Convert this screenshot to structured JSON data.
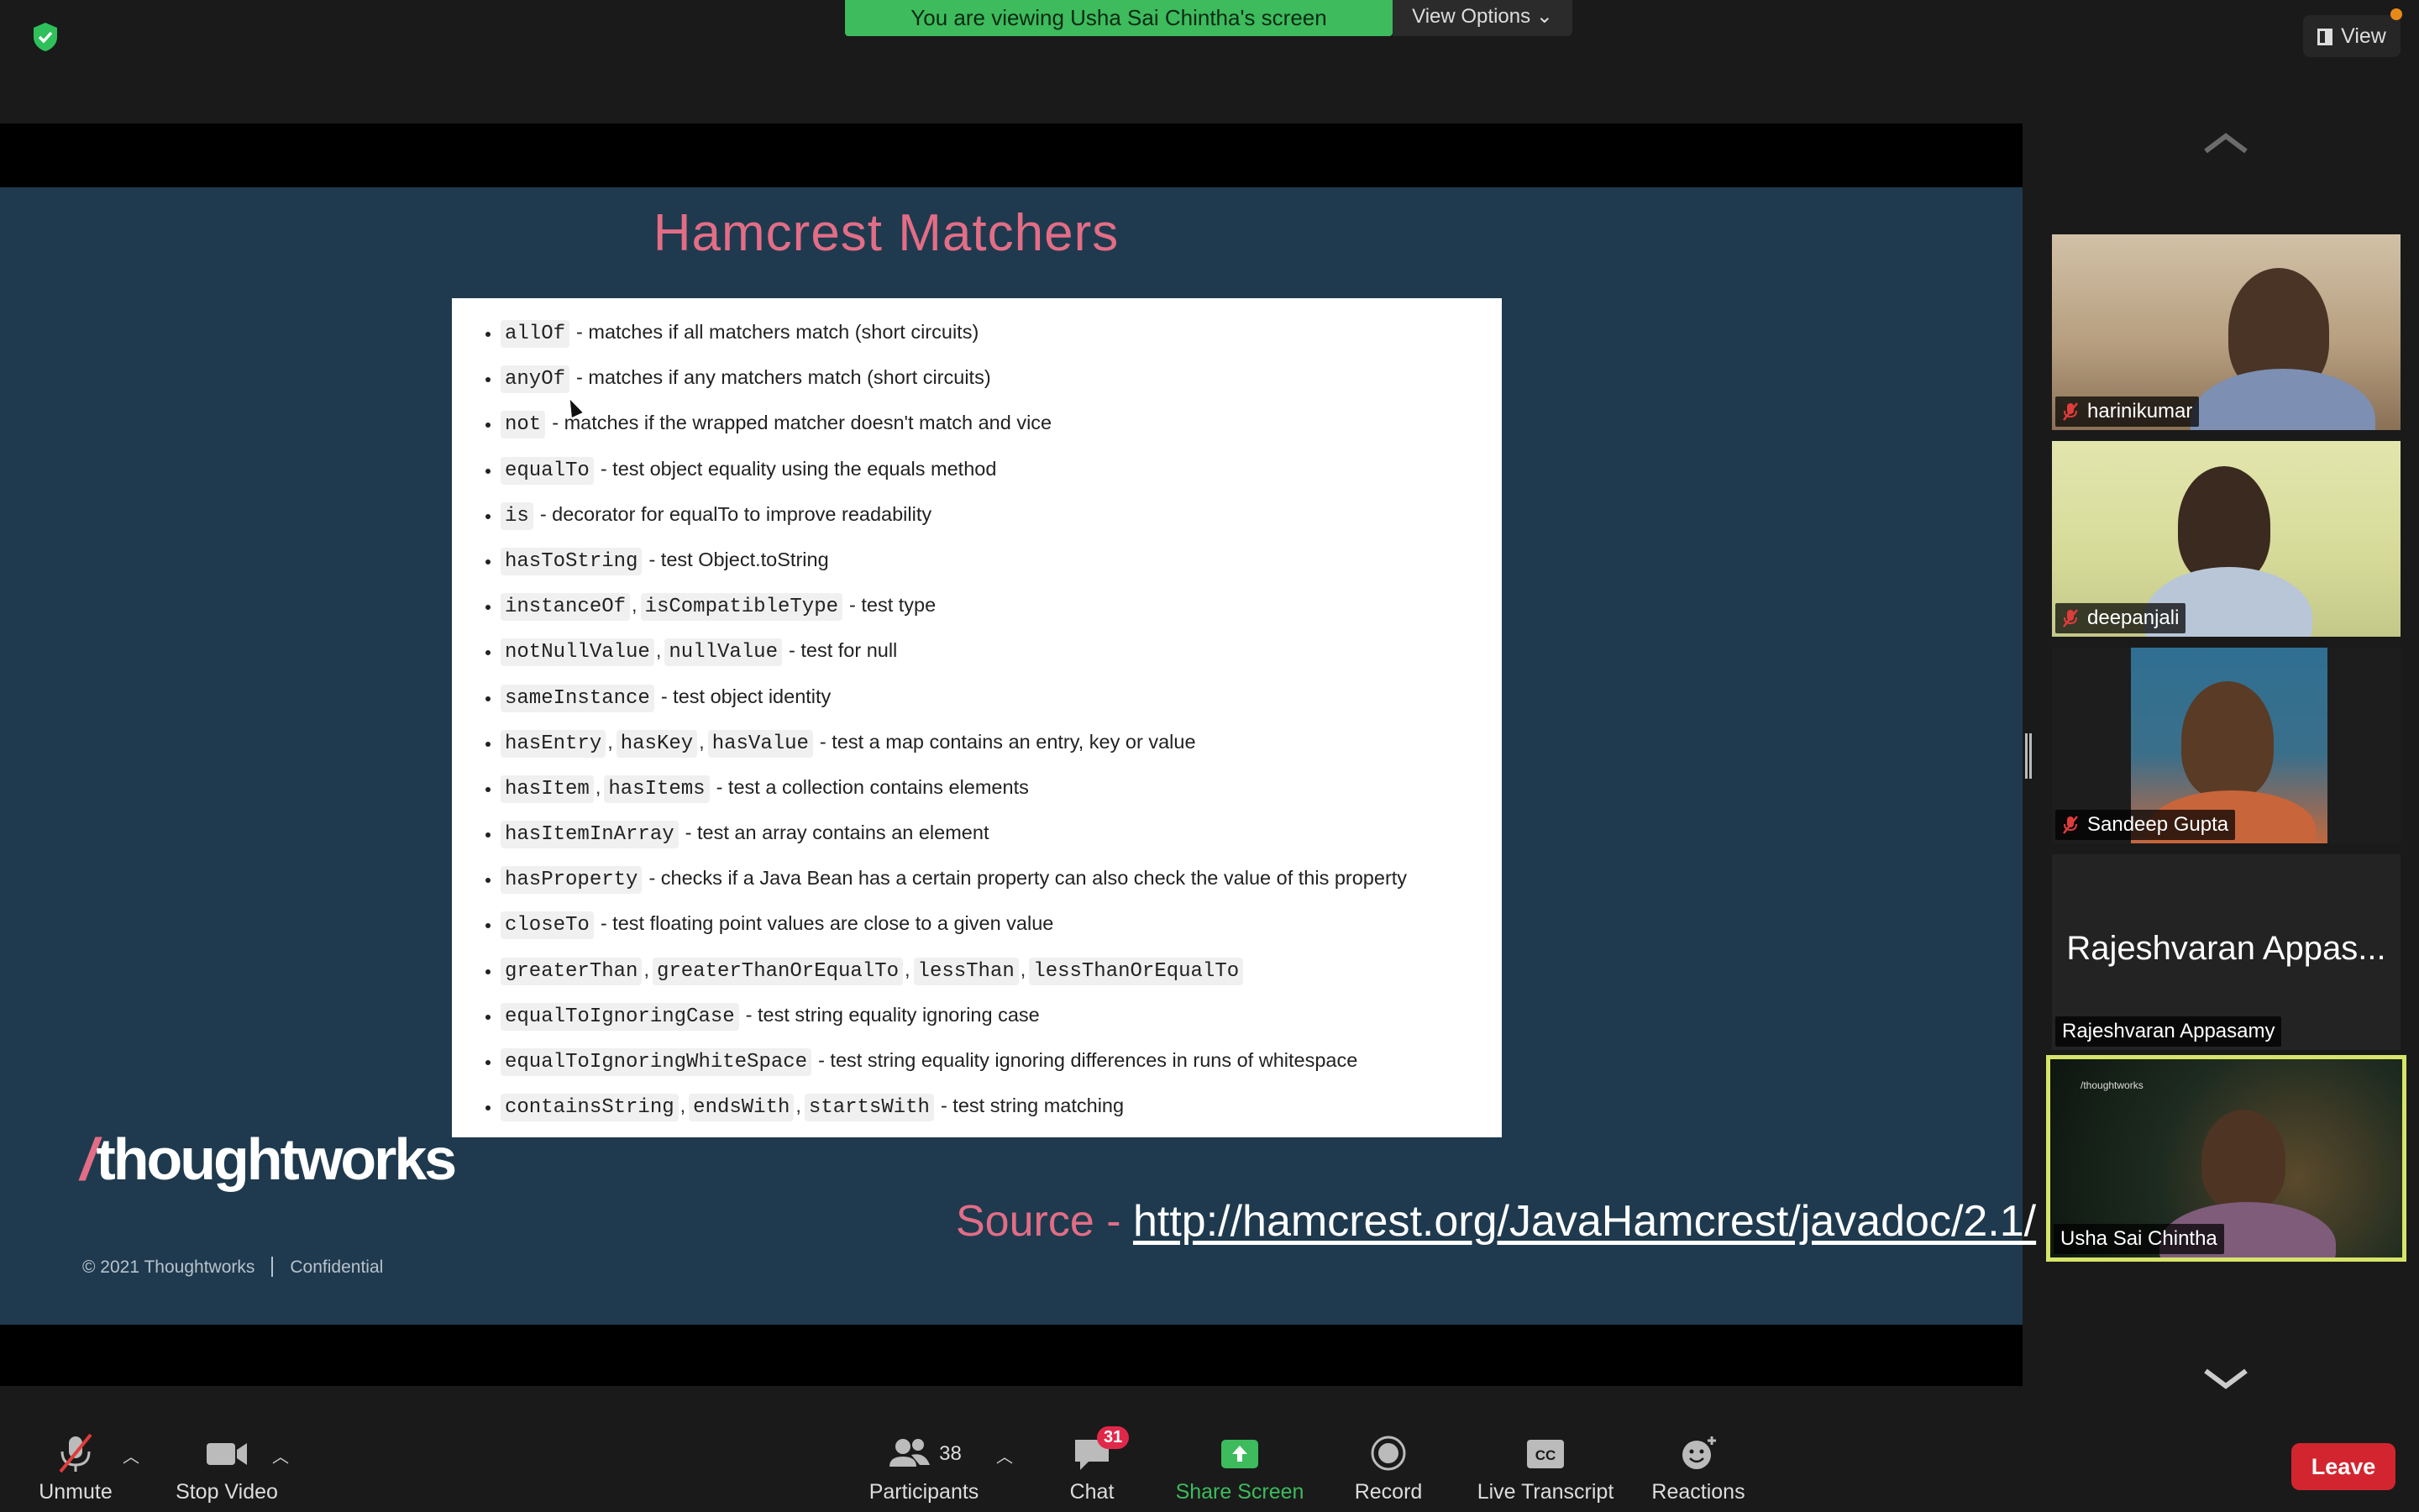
{
  "banner": {
    "text": "You are viewing Usha Sai Chintha's screen",
    "view_options": "View Options",
    "color": "#3dbb5d"
  },
  "top_right": {
    "view_label": "View"
  },
  "slide": {
    "title": "Hamcrest Matchers",
    "items": [
      {
        "codes": [
          "allOf"
        ],
        "desc": "- matches if all matchers match (short circuits)"
      },
      {
        "codes": [
          "anyOf"
        ],
        "desc": "- matches if any matchers match (short circuits)"
      },
      {
        "codes": [
          "not"
        ],
        "desc": "- matches if the wrapped matcher doesn't match and vice"
      },
      {
        "codes": [
          "equalTo"
        ],
        "desc": "- test object equality using the equals method"
      },
      {
        "codes": [
          "is"
        ],
        "desc": "- decorator for equalTo to improve readability"
      },
      {
        "codes": [
          "hasToString"
        ],
        "desc": "- test Object.toString"
      },
      {
        "codes": [
          "instanceOf",
          "isCompatibleType"
        ],
        "desc": "- test type"
      },
      {
        "codes": [
          "notNullValue",
          "nullValue"
        ],
        "desc": "- test for null"
      },
      {
        "codes": [
          "sameInstance"
        ],
        "desc": "- test object identity"
      },
      {
        "codes": [
          "hasEntry",
          "hasKey",
          "hasValue"
        ],
        "desc": "- test a map contains an entry, key or value"
      },
      {
        "codes": [
          "hasItem",
          "hasItems"
        ],
        "desc": "- test a collection contains elements"
      },
      {
        "codes": [
          "hasItemInArray"
        ],
        "desc": "- test an array contains an element"
      },
      {
        "codes": [
          "hasProperty"
        ],
        "desc": "- checks if a Java Bean has a certain property can also check the value of this property"
      },
      {
        "codes": [
          "closeTo"
        ],
        "desc": "- test floating point values are close to a given value"
      },
      {
        "codes": [
          "greaterThan",
          "greaterThanOrEqualTo",
          "lessThan",
          "lessThanOrEqualTo"
        ],
        "desc": ""
      },
      {
        "codes": [
          "equalToIgnoringCase"
        ],
        "desc": "- test string equality ignoring case"
      },
      {
        "codes": [
          "equalToIgnoringWhiteSpace"
        ],
        "desc": "- test string equality ignoring differences in runs of whitespace"
      },
      {
        "codes": [
          "containsString",
          "endsWith",
          "startsWith"
        ],
        "desc": "- test string matching"
      }
    ],
    "logo_slash": "/",
    "logo_text": "thoughtworks",
    "copyright": "© 2021 Thoughtworks",
    "confidential": "Confidential",
    "source_label": "Source - ",
    "source_url": "http://hamcrest.org/JavaHamcrest/javadoc/2.1/",
    "accent_color": "#e36d86"
  },
  "gallery": {
    "participants": [
      {
        "name": "harinikumar",
        "muted": true
      },
      {
        "name": "deepanjali",
        "muted": true
      },
      {
        "name": "Sandeep Gupta",
        "muted": true
      },
      {
        "name": "Rajeshvaran Appasamy",
        "display_name": "Rajeshvaran Appas...",
        "muted": false
      },
      {
        "name": "Usha Sai Chintha",
        "muted": false,
        "active_speaker": true,
        "background_text": "/thoughtworks"
      }
    ]
  },
  "toolbar": {
    "unmute": "Unmute",
    "stop_video": "Stop Video",
    "participants": "Participants",
    "participants_count": "38",
    "chat": "Chat",
    "chat_badge": "31",
    "share_screen": "Share Screen",
    "record": "Record",
    "live_transcript": "Live Transcript",
    "reactions": "Reactions",
    "leave": "Leave",
    "leave_color": "#d3252f",
    "share_color": "#3dbb5d"
  }
}
